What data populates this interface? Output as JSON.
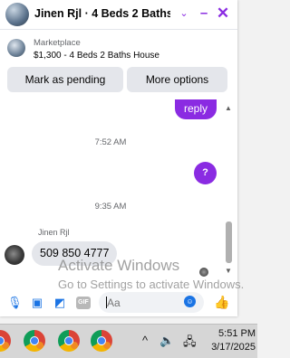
{
  "chat": {
    "title": "Jinen Rjl · 4 Beds 2 Baths ...",
    "controls": {
      "chevron": "⌄",
      "minimize": "–",
      "close": "✕"
    },
    "listing": {
      "source": "Marketplace",
      "title": "$1,300 - 4 Beds 2 Baths House"
    },
    "actions": {
      "pending_label": "Mark as pending",
      "options_label": "More options"
    },
    "messages": {
      "reply_text": "reply",
      "time1": "7:52 AM",
      "question_text": "?",
      "time2": "9:35 AM",
      "sender_name": "Jinen Rjl",
      "phone_text": "509 850 4777"
    },
    "composer": {
      "placeholder": "Aa",
      "gif_label": "GIF"
    },
    "colors": {
      "accent": "#8a2be2",
      "messenger_blue": "#1b74e4"
    },
    "icons": [
      "microphone-icon",
      "photo-icon",
      "sticker-icon",
      "gif-icon",
      "emoji-icon",
      "thumbs-up-icon"
    ]
  },
  "watermark": {
    "line1": "Activate Windows",
    "line2": "Go to Settings to activate Windows."
  },
  "taskbar": {
    "tray_chevron": "^",
    "speaker": "🔈",
    "network": "🖧",
    "time": "5:51 PM",
    "date": "3/17/2025"
  }
}
